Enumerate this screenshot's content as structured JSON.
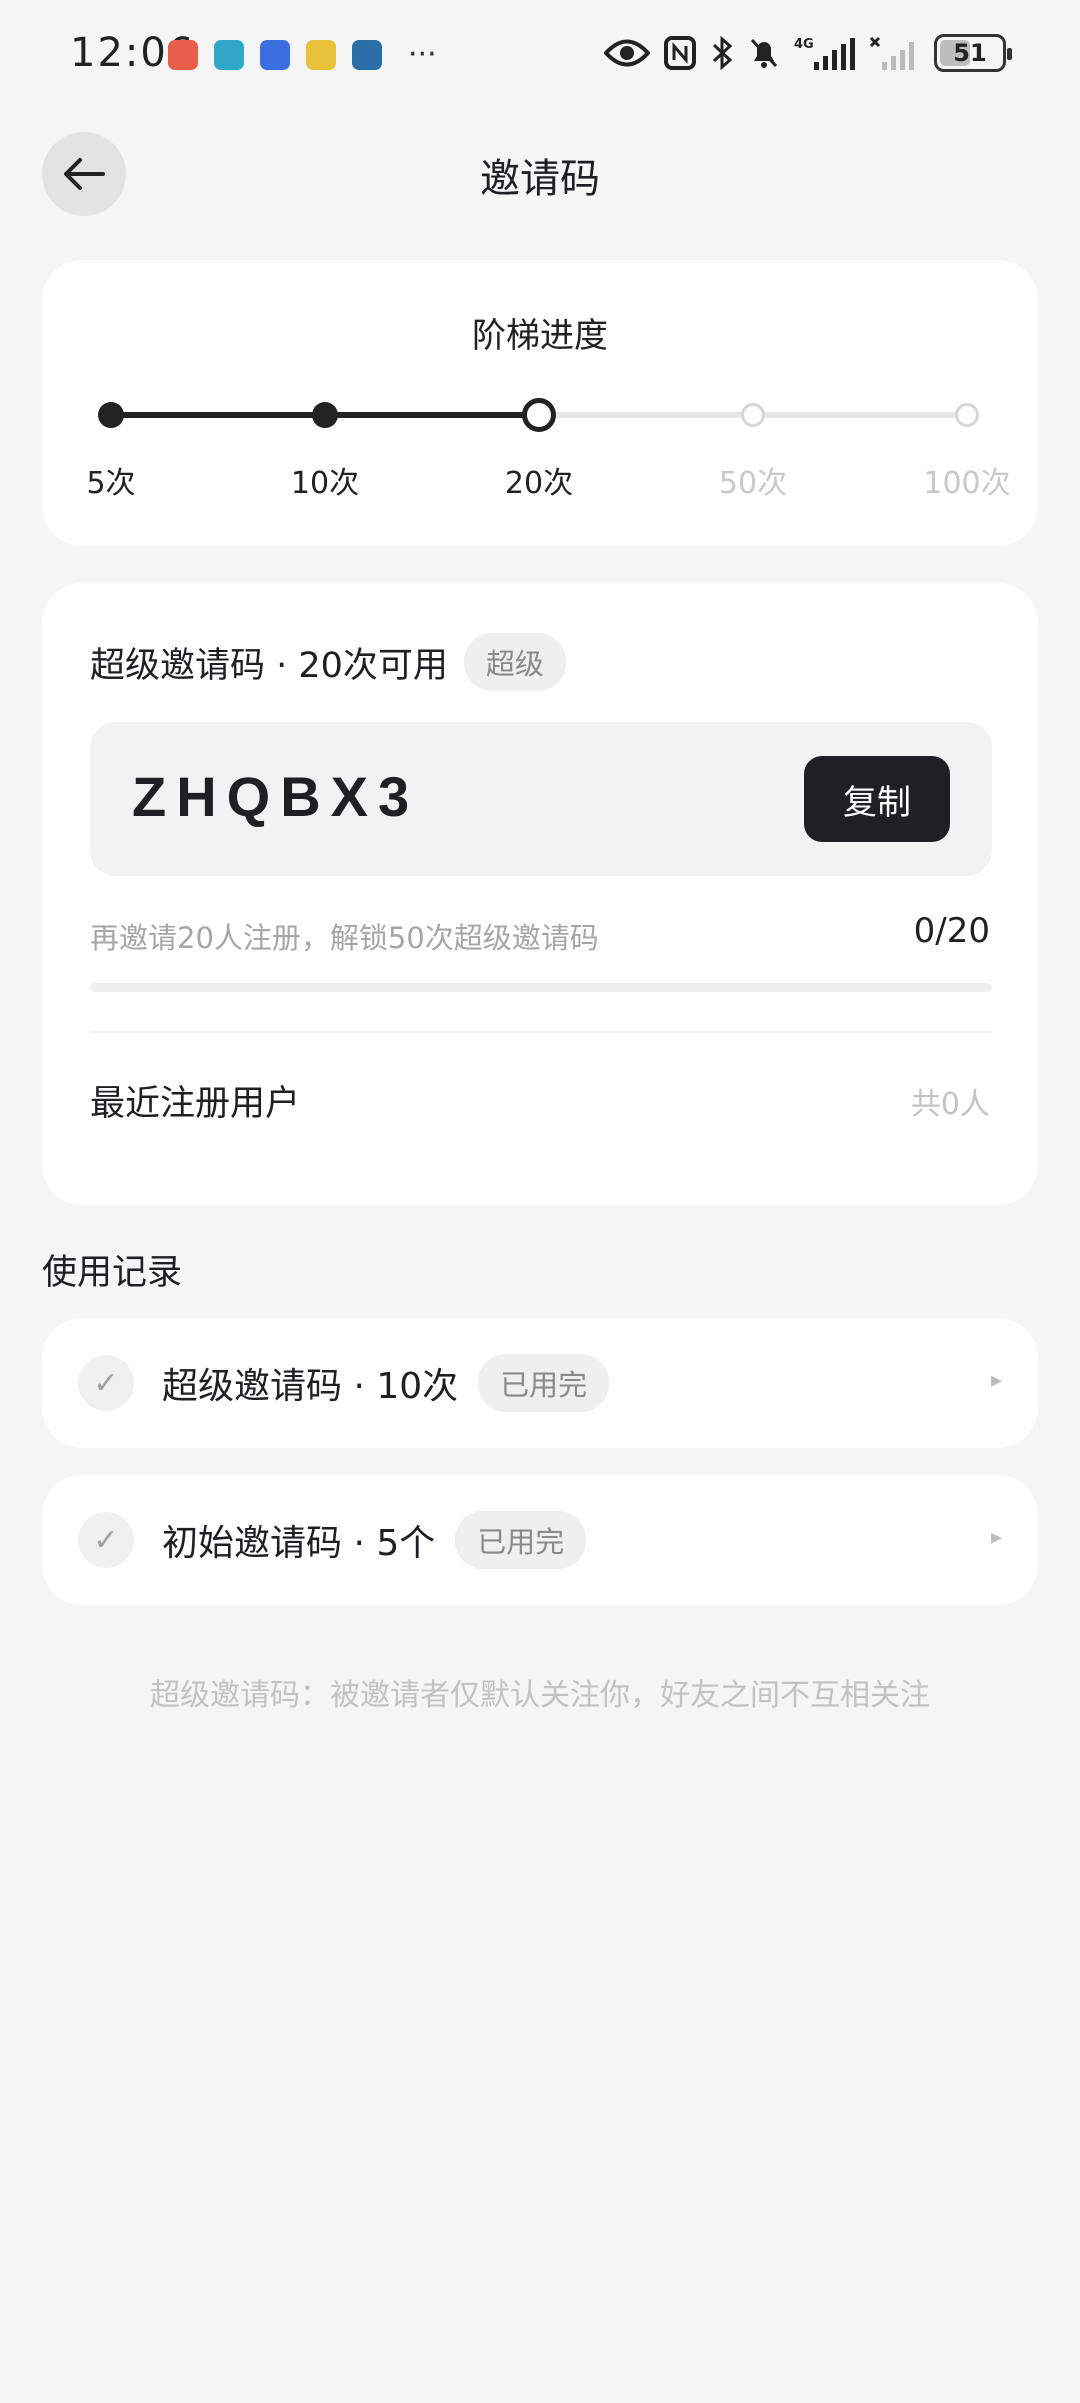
{
  "status_bar": {
    "time": "12:06",
    "app_icons": [
      {
        "name": "red-app-icon",
        "color": "#e8604c"
      },
      {
        "name": "teal-app-icon",
        "color": "#2fa7c9"
      },
      {
        "name": "blue-app-icon",
        "color": "#3b6fe0"
      },
      {
        "name": "yellow-app-icon",
        "color": "#e8c23b"
      },
      {
        "name": "dark-app-icon",
        "color": "#2c6fa8"
      }
    ],
    "more": "···",
    "network": "4G",
    "battery": "51"
  },
  "header": {
    "title": "邀请码"
  },
  "progress": {
    "title": "阶梯进度",
    "steps": [
      {
        "label": "5次",
        "state": "done"
      },
      {
        "label": "10次",
        "state": "done"
      },
      {
        "label": "20次",
        "state": "current"
      },
      {
        "label": "50次",
        "state": "future"
      },
      {
        "label": "100次",
        "state": "future"
      }
    ]
  },
  "code_card": {
    "title": "超级邀请码 · 20次可用",
    "badge": "超级",
    "code": "ZHQBX3",
    "copy_label": "复制",
    "unlock_hint": "再邀请20人注册，解锁50次超级邀请码",
    "unlock_count": "0/20",
    "unlock_progress": 0,
    "recent_label": "最近注册用户",
    "recent_count": "共0人"
  },
  "records": {
    "title": "使用记录",
    "items": [
      {
        "label": "超级邀请码 · 10次",
        "status": "已用完"
      },
      {
        "label": "初始邀请码 · 5个",
        "status": "已用完"
      }
    ]
  },
  "footnote": "超级邀请码：被邀请者仅默认关注你，好友之间不互相关注",
  "colors": {
    "background": "#f5f5f5",
    "card": "#ffffff",
    "primary": "#1f1f24",
    "muted": "#a6a6a6",
    "track_inactive": "#e6e6e6"
  }
}
